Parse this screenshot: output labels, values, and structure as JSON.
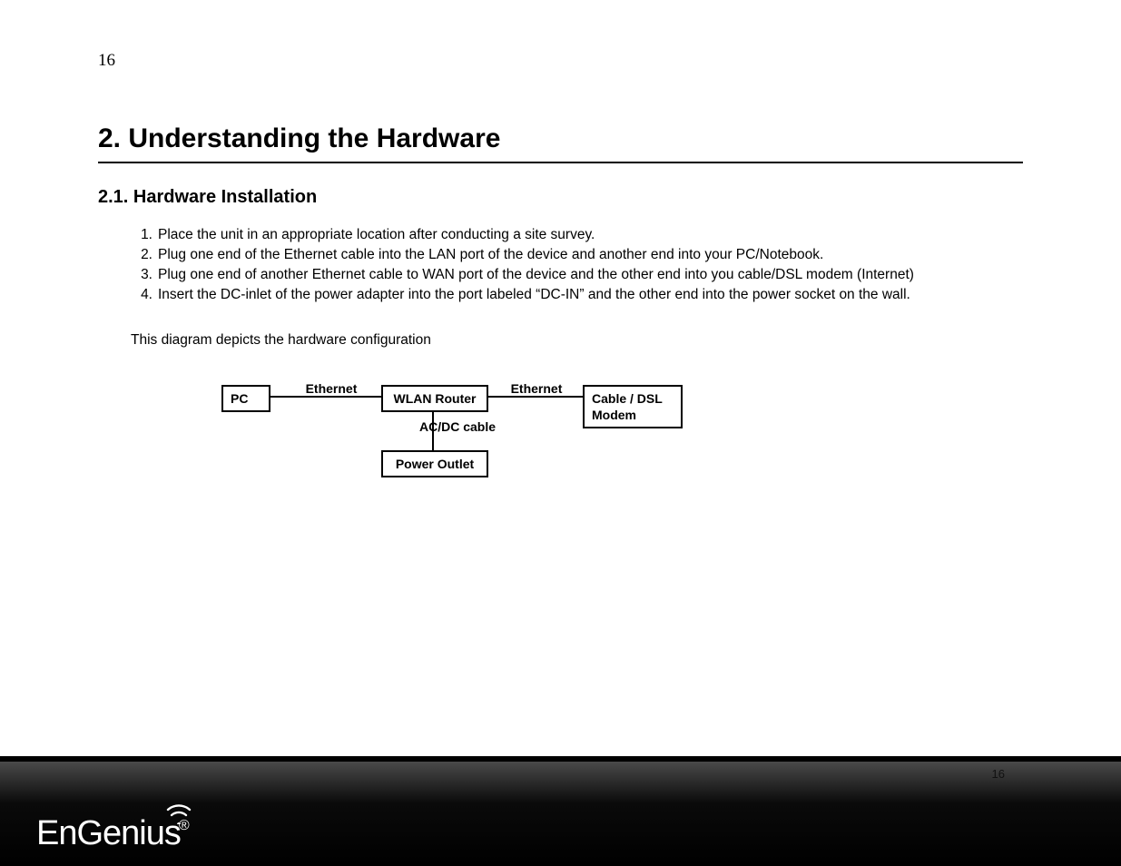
{
  "header_page_number": "16",
  "title": "2. Understanding the Hardware",
  "subtitle": "2.1.   Hardware Installation",
  "steps": [
    {
      "num": "1.",
      "text": "Place the unit in an appropriate location after conducting a site survey."
    },
    {
      "num": "2.",
      "text": "Plug one end of the Ethernet cable into the LAN port of the device and another end into your PC/Notebook."
    },
    {
      "num": "3.",
      "text": "Plug one end of another Ethernet cable to WAN port of the device and the other end into you cable/DSL modem (Internet)"
    },
    {
      "num": "4.",
      "text": "Insert the DC-inlet of the power adapter into the port labeled “DC-IN” and the other end into the power socket on the wall."
    }
  ],
  "diagram_caption": "This diagram depicts the hardware configuration",
  "diagram": {
    "pc": "PC",
    "router": "WLAN Router",
    "modem": "Cable / DSL Modem",
    "power": "Power Outlet",
    "ethernet1": "Ethernet",
    "ethernet2": "Ethernet",
    "acdc": "AC/DC cable"
  },
  "footer": {
    "page_number": "16",
    "brand": "EnGenius",
    "reg": "®"
  }
}
